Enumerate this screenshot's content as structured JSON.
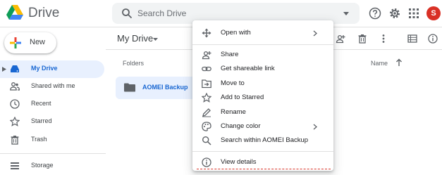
{
  "app": {
    "name": "Drive",
    "logo_icon": "google-drive-logo"
  },
  "search": {
    "placeholder": "Search Drive",
    "icon": "search-icon",
    "options_icon": "caret-down-icon"
  },
  "header_actions": {
    "help_icon": "help-icon",
    "settings_icon": "gear-icon",
    "apps_icon": "apps-grid-icon",
    "avatar_initial": "S",
    "avatar_color": "#d93025"
  },
  "sidebar": {
    "new_label": "New",
    "items": [
      {
        "label": "My Drive",
        "icon": "my-drive-icon",
        "active": true
      },
      {
        "label": "Shared with me",
        "icon": "shared-people-icon",
        "active": false
      },
      {
        "label": "Recent",
        "icon": "clock-icon",
        "active": false
      },
      {
        "label": "Starred",
        "icon": "star-icon",
        "active": false
      },
      {
        "label": "Trash",
        "icon": "trash-icon",
        "active": false
      },
      {
        "label": "Storage",
        "icon": "storage-icon",
        "active": false
      }
    ]
  },
  "main": {
    "title": "My Drive",
    "toolbar_icons": [
      "add-person-icon",
      "trash-icon",
      "more-vert-icon",
      "list-view-icon",
      "info-icon"
    ],
    "folders_label": "Folders",
    "sort_label": "Name",
    "sort_direction_icon": "arrow-up-icon",
    "folders": [
      {
        "name": "AOMEI Backup",
        "icon": "folder-icon"
      }
    ]
  },
  "context_menu": {
    "items": [
      {
        "label": "Open with",
        "icon": "open-with-icon",
        "submenu": true
      },
      {
        "label": "Share",
        "icon": "share-person-icon",
        "submenu": false
      },
      {
        "label": "Get shareable link",
        "icon": "link-icon",
        "submenu": false
      },
      {
        "label": "Move to",
        "icon": "move-to-icon",
        "submenu": false
      },
      {
        "label": "Add to Starred",
        "icon": "star-icon",
        "submenu": false
      },
      {
        "label": "Rename",
        "icon": "pencil-icon",
        "submenu": false
      },
      {
        "label": "Change color",
        "icon": "palette-icon",
        "submenu": true
      },
      {
        "label": "Search within AOMEI Backup",
        "icon": "search-icon",
        "submenu": false
      },
      {
        "label": "View details",
        "icon": "info-icon",
        "submenu": false
      }
    ]
  },
  "colors": {
    "accent": "#1967d2",
    "selection": "#e8f0fe",
    "highlight_dash": "#d93025"
  }
}
